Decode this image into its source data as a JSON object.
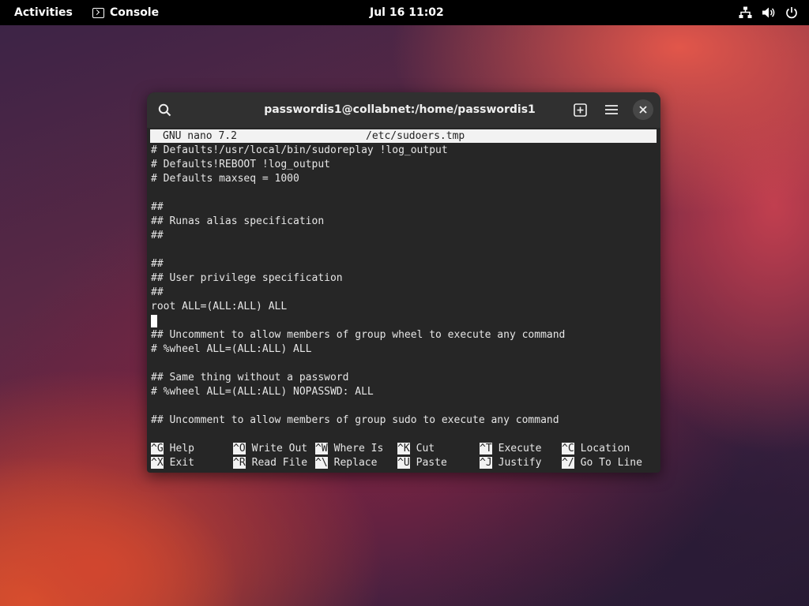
{
  "topbar": {
    "activities": "Activities",
    "app_name": "Console",
    "clock": "Jul 16  11:02",
    "icons": [
      "network-icon",
      "volume-icon",
      "power-icon"
    ]
  },
  "window": {
    "title": "passwordis1@collabnet:/home/passwordis1",
    "buttons": [
      "search-icon",
      "new-tab-icon",
      "hamburger-menu-icon",
      "close-icon"
    ]
  },
  "nano": {
    "version": "GNU nano 7.2",
    "filename": "/etc/sudoers.tmp",
    "lines": [
      "# Defaults!/usr/local/bin/sudoreplay !log_output",
      "# Defaults!REBOOT !log_output",
      "# Defaults maxseq = 1000",
      "",
      "##",
      "## Runas alias specification",
      "##",
      "",
      "##",
      "## User privilege specification",
      "##",
      "root ALL=(ALL:ALL) ALL",
      "",
      "## Uncomment to allow members of group wheel to execute any command",
      "# %wheel ALL=(ALL:ALL) ALL",
      "",
      "## Same thing without a password",
      "# %wheel ALL=(ALL:ALL) NOPASSWD: ALL",
      "",
      "## Uncomment to allow members of group sudo to execute any command"
    ],
    "shortcuts": [
      {
        "key": "^G",
        "label": "Help"
      },
      {
        "key": "^O",
        "label": "Write Out"
      },
      {
        "key": "^W",
        "label": "Where Is"
      },
      {
        "key": "^K",
        "label": "Cut"
      },
      {
        "key": "^T",
        "label": "Execute"
      },
      {
        "key": "^C",
        "label": "Location"
      },
      {
        "key": "^X",
        "label": "Exit"
      },
      {
        "key": "^R",
        "label": "Read File"
      },
      {
        "key": "^\\",
        "label": "Replace"
      },
      {
        "key": "^U",
        "label": "Paste"
      },
      {
        "key": "^J",
        "label": "Justify"
      },
      {
        "key": "^/",
        "label": "Go To Line"
      }
    ]
  }
}
